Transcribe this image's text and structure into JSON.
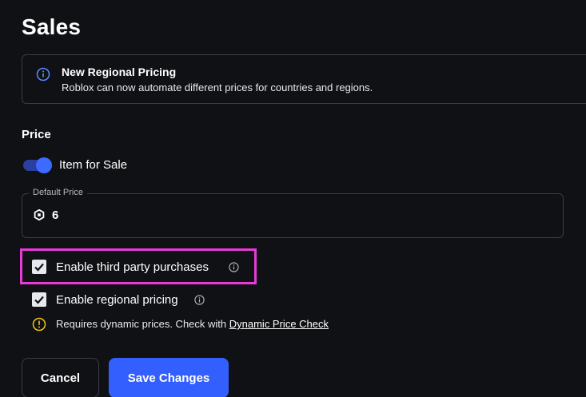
{
  "page": {
    "title": "Sales"
  },
  "banner": {
    "icon": "info-icon",
    "title": "New Regional Pricing",
    "text": "Roblox can now automate different prices for countries and regions."
  },
  "price": {
    "section_label": "Price",
    "item_for_sale": {
      "label": "Item for Sale",
      "on": true
    },
    "default_price": {
      "legend": "Default Price",
      "currency_icon": "robux-icon",
      "value": "6"
    }
  },
  "options": {
    "third_party": {
      "label": "Enable third party purchases",
      "checked": true,
      "highlighted": true
    },
    "regional": {
      "label": "Enable regional pricing",
      "checked": true
    },
    "warning": {
      "icon": "warning-icon",
      "text": "Requires dynamic prices. Check with ",
      "link": "Dynamic Price Check"
    }
  },
  "actions": {
    "cancel": "Cancel",
    "save": "Save Changes"
  },
  "colors": {
    "background": "#101114",
    "accent": "#335fff",
    "highlight": "#e83ad7",
    "warning": "#f5c518",
    "info": "#5b8cff"
  }
}
